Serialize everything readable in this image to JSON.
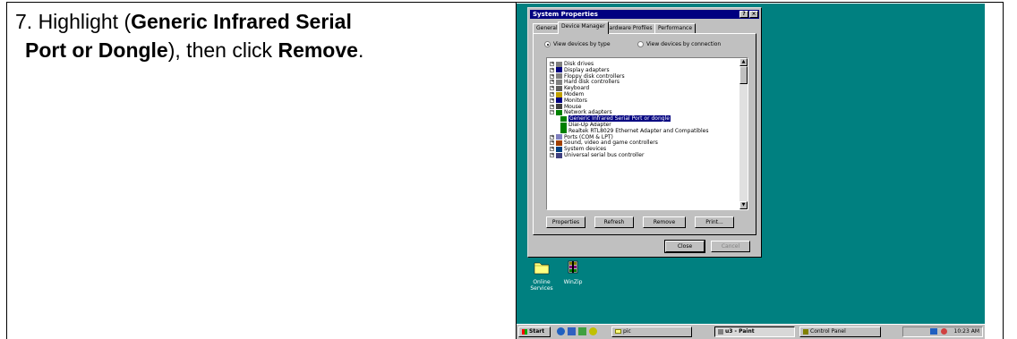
{
  "instruction": {
    "step_prefix": "7. Highlight (",
    "device_name_bold_line1": "Generic Infrared Serial",
    "device_name_bold_line2": "Port or Dongle",
    "middle": "), then click ",
    "action_bold": "Remove",
    "end": "."
  },
  "dialog": {
    "title": "System Properties",
    "help_glyph": "?",
    "close_glyph": "×",
    "tabs": [
      "General",
      "Device Manager",
      "Hardware Profiles",
      "Performance"
    ],
    "radio_by_type": "View devices by type",
    "radio_by_connection": "View devices by connection",
    "tree": [
      {
        "label": "Disk drives",
        "level": 0,
        "expander": "+",
        "icon": "disk-icon"
      },
      {
        "label": "Display adapters",
        "level": 0,
        "expander": "+",
        "icon": "monitor-icon"
      },
      {
        "label": "Floppy disk controllers",
        "level": 0,
        "expander": "+",
        "icon": "disk-icon"
      },
      {
        "label": "Hard disk controllers",
        "level": 0,
        "expander": "+",
        "icon": "disk-icon"
      },
      {
        "label": "Keyboard",
        "level": 0,
        "expander": "+",
        "icon": "keyboard-icon"
      },
      {
        "label": "Modem",
        "level": 0,
        "expander": "+",
        "icon": "modem-icon"
      },
      {
        "label": "Monitors",
        "level": 0,
        "expander": "+",
        "icon": "monitor-icon"
      },
      {
        "label": "Mouse",
        "level": 0,
        "expander": "+",
        "icon": "mouse-icon"
      },
      {
        "label": "Network adapters",
        "level": 0,
        "expander": "−",
        "icon": "network-card-icon"
      },
      {
        "label": "Generic Infrared Serial Port or dongle",
        "level": 1,
        "expander": "",
        "icon": "network-card-icon",
        "selected": true
      },
      {
        "label": "Dial-Up Adapter",
        "level": 1,
        "expander": "",
        "icon": "network-card-icon"
      },
      {
        "label": "Realtek RTL8029 Ethernet Adapter and Compatibles",
        "level": 1,
        "expander": "",
        "icon": "network-card-icon"
      },
      {
        "label": "Ports (COM & LPT)",
        "level": 0,
        "expander": "+",
        "icon": "port-icon"
      },
      {
        "label": "Sound, video and game controllers",
        "level": 0,
        "expander": "+",
        "icon": "sound-icon"
      },
      {
        "label": "System devices",
        "level": 0,
        "expander": "+",
        "icon": "computer-icon"
      },
      {
        "label": "Universal serial bus controller",
        "level": 0,
        "expander": "+",
        "icon": "usb-icon"
      }
    ],
    "buttons": {
      "properties": "Properties",
      "refresh": "Refresh",
      "remove": "Remove",
      "print": "Print...",
      "close": "Close",
      "cancel": "Cancel"
    }
  },
  "desktop_icons": [
    {
      "label_line1": "Online",
      "label_line2": "Services"
    },
    {
      "label_line1": "WinZip",
      "label_line2": ""
    }
  ],
  "taskbar": {
    "start": "Start",
    "tasks": [
      "pic",
      "u3 - Paint",
      "Control Panel"
    ],
    "clock": "10:23 AM"
  },
  "colors": {
    "desktop": "#008080",
    "title_bar": "#000080",
    "face": "#c0c0c0"
  }
}
